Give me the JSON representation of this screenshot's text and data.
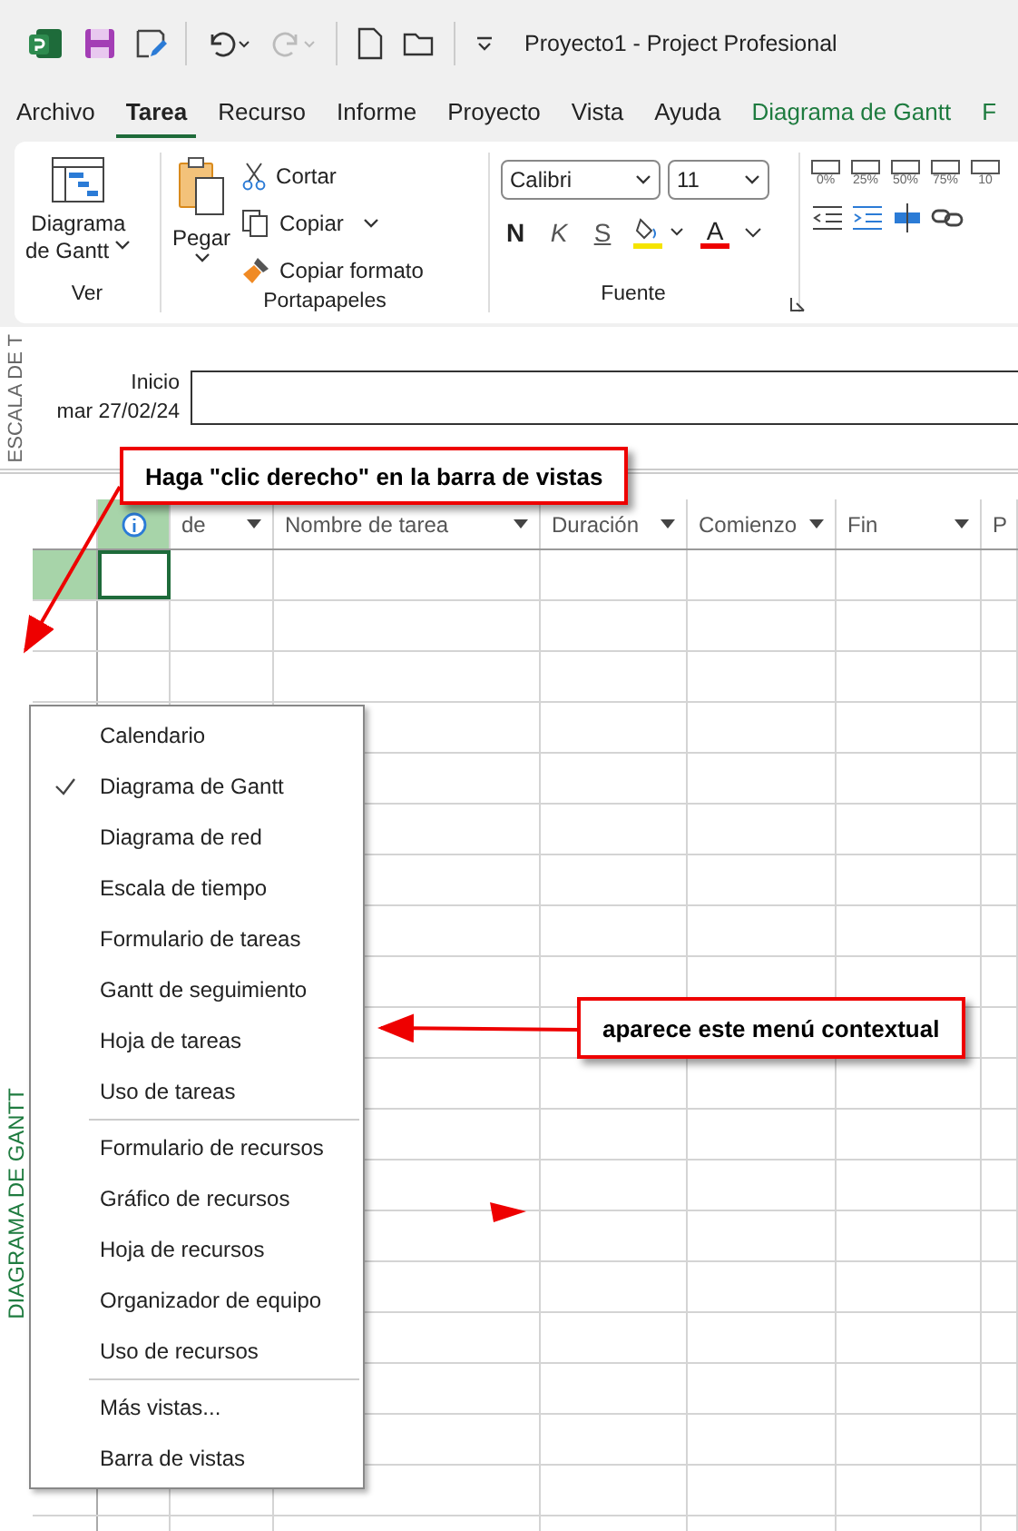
{
  "title_bar": {
    "title": "Proyecto1  -  Project Profesional"
  },
  "menu_tabs": [
    {
      "label": "Archivo",
      "selected": false,
      "kind": "normal"
    },
    {
      "label": "Tarea",
      "selected": true,
      "kind": "normal"
    },
    {
      "label": "Recurso",
      "selected": false,
      "kind": "normal"
    },
    {
      "label": "Informe",
      "selected": false,
      "kind": "normal"
    },
    {
      "label": "Proyecto",
      "selected": false,
      "kind": "normal"
    },
    {
      "label": "Vista",
      "selected": false,
      "kind": "normal"
    },
    {
      "label": "Ayuda",
      "selected": false,
      "kind": "normal"
    },
    {
      "label": "Diagrama de Gantt",
      "selected": false,
      "kind": "context"
    },
    {
      "label": "F",
      "selected": false,
      "kind": "context"
    }
  ],
  "ribbon": {
    "view_group": {
      "button_line1": "Diagrama",
      "button_line2": "de Gantt",
      "label": "Ver"
    },
    "clipboard_group": {
      "paste": "Pegar",
      "cut": "Cortar",
      "copy": "Copiar",
      "format_painter": "Copiar formato",
      "label": "Portapapeles"
    },
    "font_group": {
      "font": "Calibri",
      "size": "11",
      "bold": "N",
      "italic": "K",
      "strike": "S",
      "font_color": "A",
      "label": "Fuente"
    },
    "progress_labels": [
      "0%",
      "25%",
      "50%",
      "75%",
      "10"
    ]
  },
  "timeline": {
    "side_label": "ESCALA DE T",
    "start_label": "Inicio",
    "start_date": "mar 27/02/24"
  },
  "table": {
    "columns": [
      "de",
      "Nombre de tarea",
      "Duración",
      "Comienzo",
      "Fin",
      "P"
    ]
  },
  "view_bar": {
    "label": "DIAGRAMA DE GANTT"
  },
  "context_menu": {
    "sections": [
      [
        {
          "label": "Calendario",
          "checked": false
        },
        {
          "label": "Diagrama de Gantt",
          "checked": true
        },
        {
          "label": "Diagrama de red",
          "checked": false
        },
        {
          "label": "Escala de tiempo",
          "checked": false
        },
        {
          "label": "Formulario de tareas",
          "checked": false
        },
        {
          "label": "Gantt de seguimiento",
          "checked": false
        },
        {
          "label": "Hoja de tareas",
          "checked": false
        },
        {
          "label": "Uso de tareas",
          "checked": false
        }
      ],
      [
        {
          "label": "Formulario de recursos",
          "checked": false
        },
        {
          "label": "Gráfico de recursos",
          "checked": false
        },
        {
          "label": "Hoja de recursos",
          "checked": false
        },
        {
          "label": "Organizador de equipo",
          "checked": false
        },
        {
          "label": "Uso de recursos",
          "checked": false
        }
      ],
      [
        {
          "label": "Más vistas...",
          "checked": false
        },
        {
          "label": "Barra de vistas",
          "checked": false
        }
      ]
    ]
  },
  "callouts": [
    {
      "text": "Haga \"clic derecho\" en la barra de vistas"
    },
    {
      "text": "aparece este menú contextual"
    }
  ]
}
